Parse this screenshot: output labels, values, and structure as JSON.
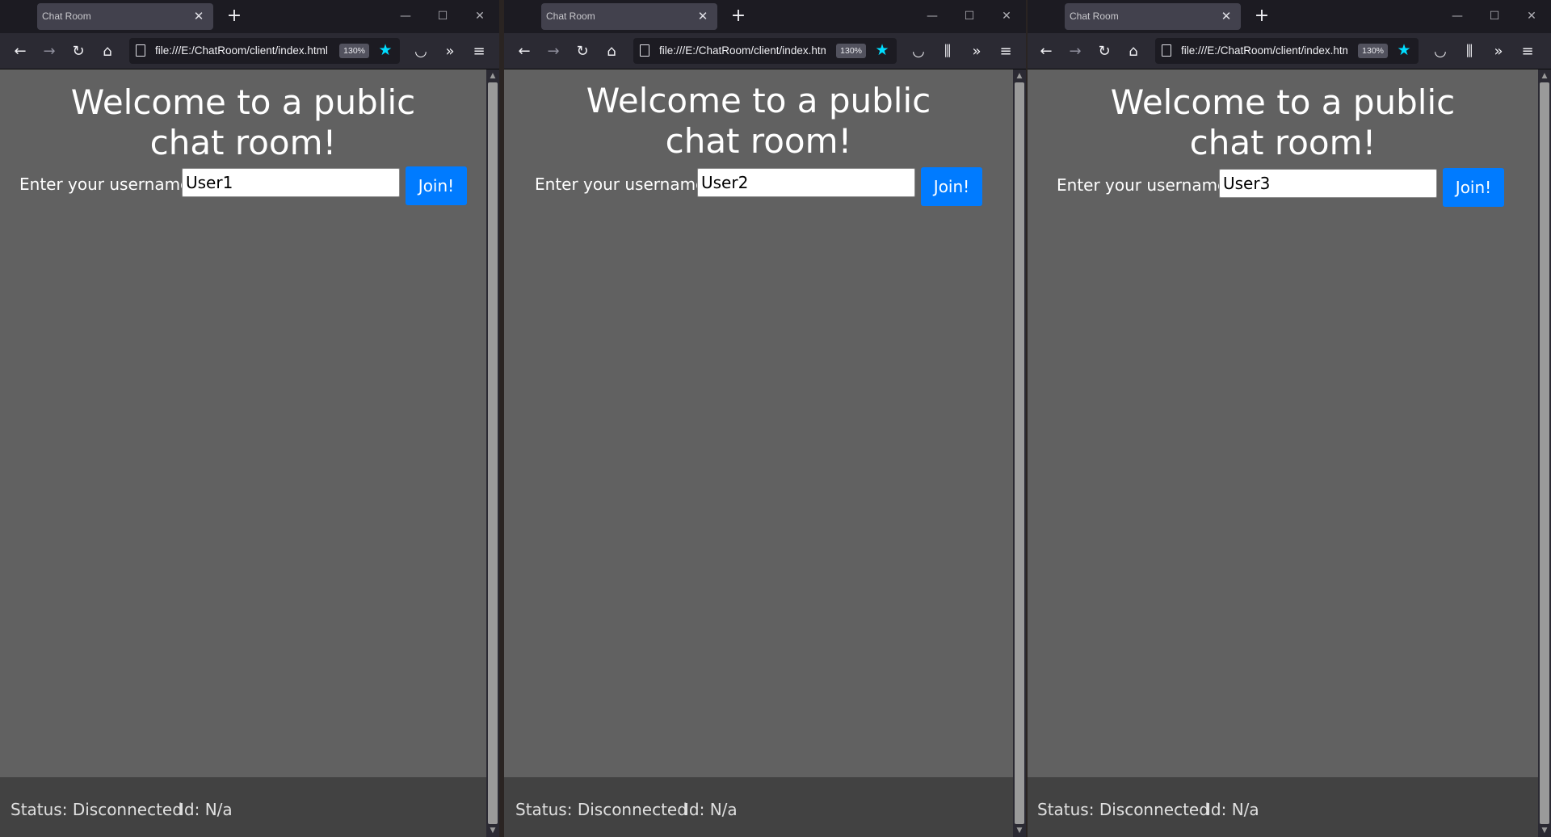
{
  "windows": [
    {
      "tab_title": "Chat Room",
      "url": "file:///E:/ChatRoom/client/index.html",
      "zoom": "130%",
      "heading": "Welcome to a public chat room!",
      "username_label": "Enter your username:",
      "username_value": "User1",
      "join_label": "Join!",
      "status": "Status: Disconnected",
      "id": "Id: N/a"
    },
    {
      "tab_title": "Chat Room",
      "url": "file:///E:/ChatRoom/client/index.html",
      "zoom": "130%",
      "heading": "Welcome to a public chat room!",
      "username_label": "Enter your username:",
      "username_value": "User2",
      "join_label": "Join!",
      "status": "Status: Disconnected",
      "id": "Id: N/a"
    },
    {
      "tab_title": "Chat Room",
      "url": "file:///E:/ChatRoom/client/index.html",
      "zoom": "130%",
      "heading": "Welcome to a public chat room!",
      "username_label": "Enter your username:",
      "username_value": "User3",
      "join_label": "Join!",
      "status": "Status: Disconnected",
      "id": "Id: N/a"
    }
  ],
  "icons": {
    "tab_close": "✕",
    "new_tab": "+",
    "minimize": "—",
    "maximize": "☐",
    "close": "✕",
    "back": "←",
    "forward": "→",
    "reload": "↻",
    "home": "⌂",
    "pocket": "◡",
    "library": "⫼",
    "overflow": "»",
    "menu": "≡",
    "star": "★"
  },
  "colors": {
    "page_bg": "#616161",
    "status_bg": "#424242",
    "join_button": "#007bff",
    "star": "#00ddff"
  }
}
